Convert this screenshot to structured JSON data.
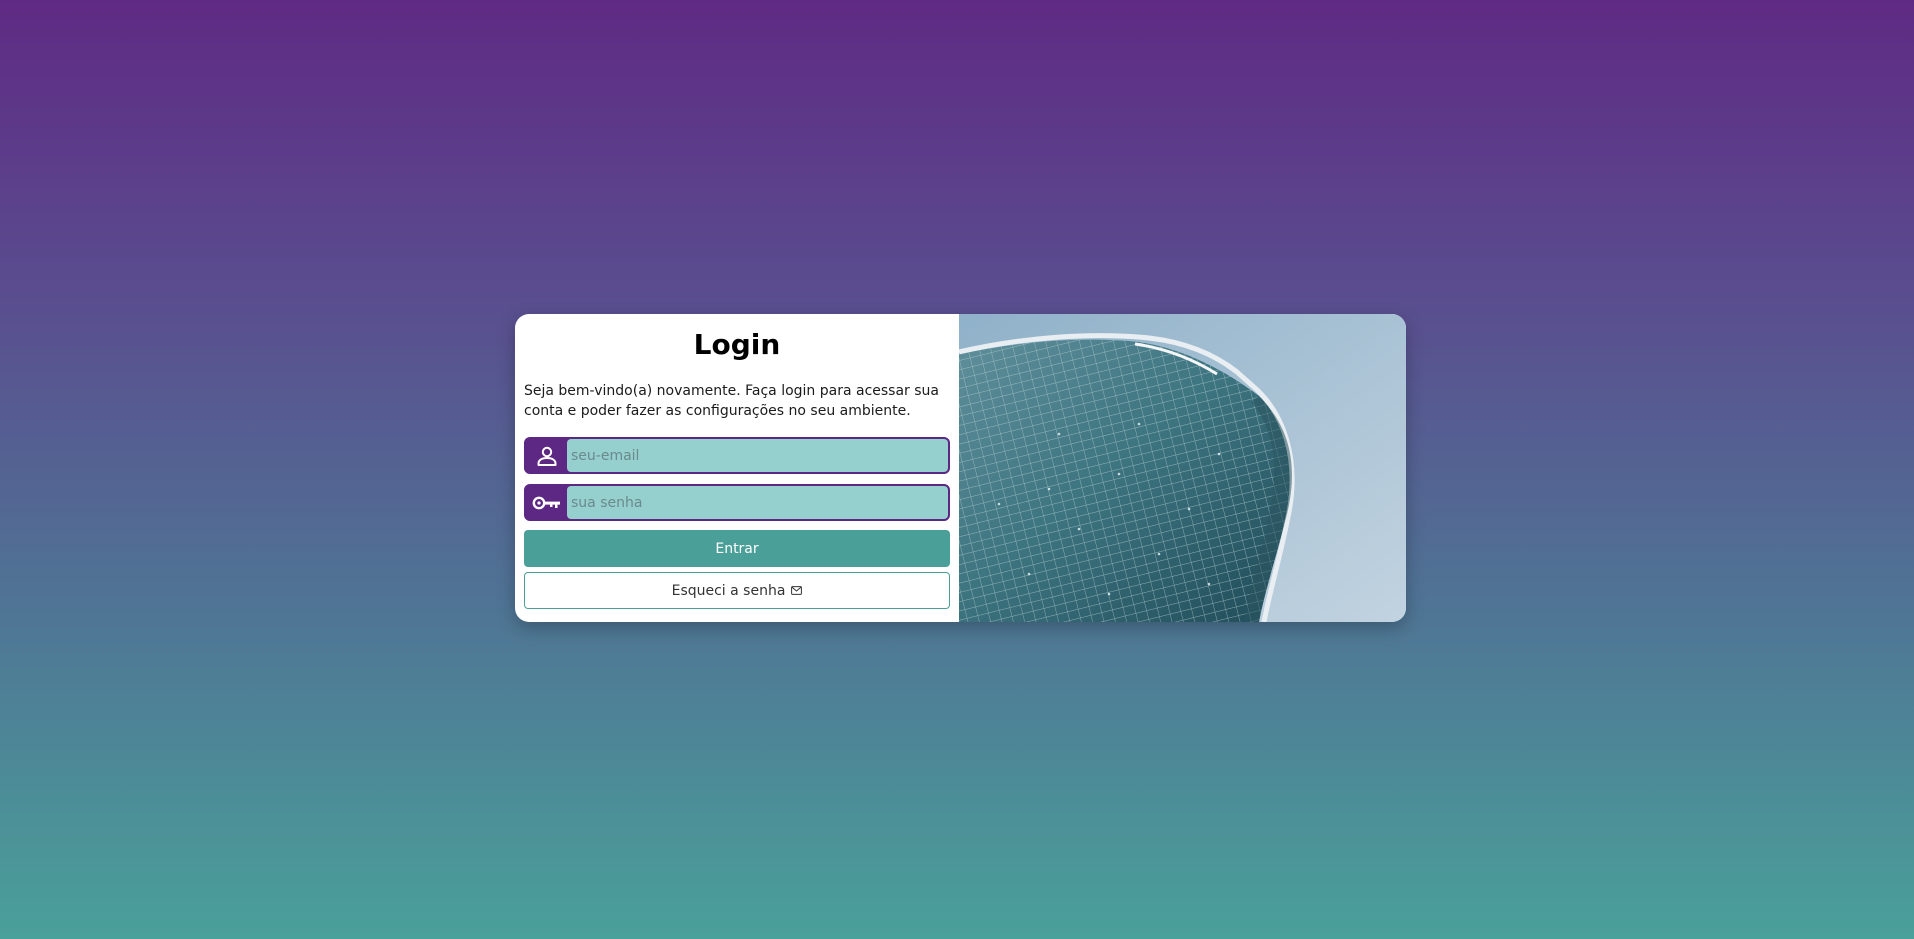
{
  "login": {
    "title": "Login",
    "welcome": "Seja bem-vindo(a) novamente. Faça login para acessar sua conta e poder fazer as configurações no seu ambiente.",
    "email_placeholder": "seu-email",
    "password_placeholder": "sua senha",
    "submit_label": "Entrar",
    "forgot_label": "Esqueci a senha"
  },
  "icons": {
    "email_field": "user-icon",
    "password_field": "key-icon",
    "forgot": "envelope-icon"
  },
  "colors": {
    "accent_purple": "#5d2784",
    "accent_teal": "#4b9f99",
    "input_bg": "#95cfce"
  }
}
